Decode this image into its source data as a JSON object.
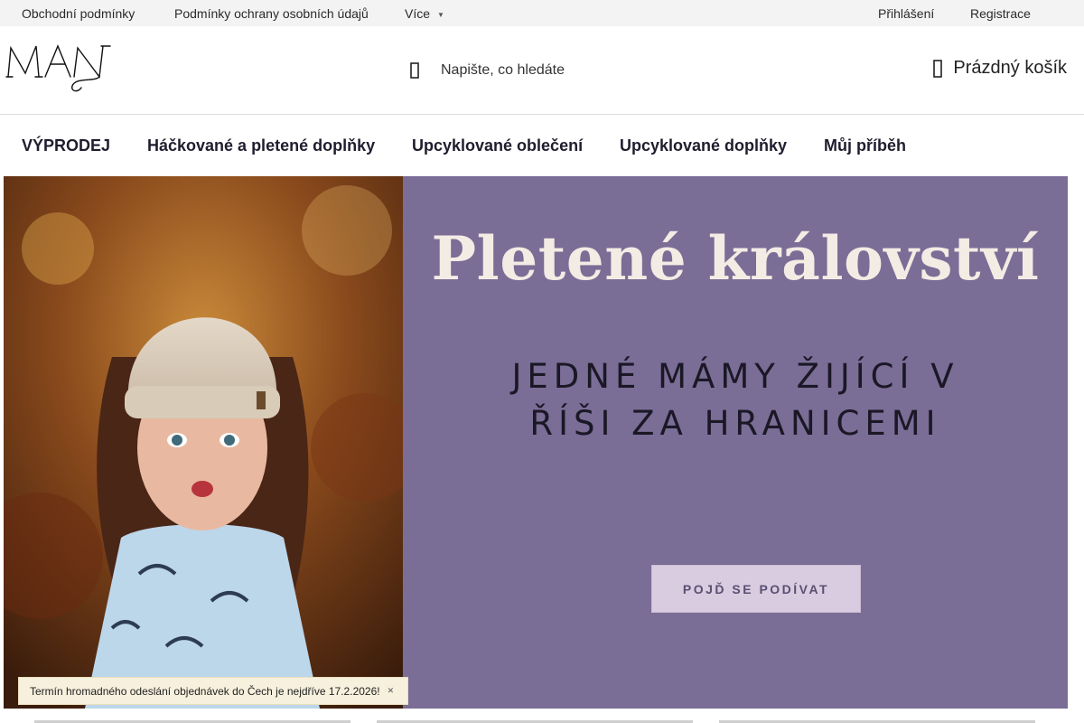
{
  "topbar": {
    "links": [
      "Obchodní podmínky",
      "Podmínky ochrany osobních údajů"
    ],
    "more_label": "Více",
    "login_label": "Přihlášení",
    "register_label": "Registrace"
  },
  "header": {
    "logo_text": "MAN",
    "search": {
      "placeholder": "Napište, co hledáte",
      "icon": "search-icon"
    },
    "cart": {
      "label": "Prázdný košík",
      "icon": "cart-icon"
    }
  },
  "nav": {
    "items": [
      "VÝPRODEJ",
      "Háčkované a pletené doplňky",
      "Upcyklované oblečení",
      "Upcyklované doplňky",
      "Můj příběh"
    ]
  },
  "hero": {
    "title": "Pletené království",
    "subtitle_line1": "JEDNÉ MÁMY ŽIJÍCÍ V",
    "subtitle_line2": "ŘÍŠI ZA HRANICEMI",
    "cta_label": "POJĎ SE PODÍVAT",
    "background_color": "#7a6d96",
    "title_color": "#f2ece4",
    "cta_color": "#d9cce0"
  },
  "notice": {
    "text": "Termín hromadného odeslání objednávek do Čech je nejdříve 17.2.2026!",
    "close_icon": "close-icon"
  }
}
